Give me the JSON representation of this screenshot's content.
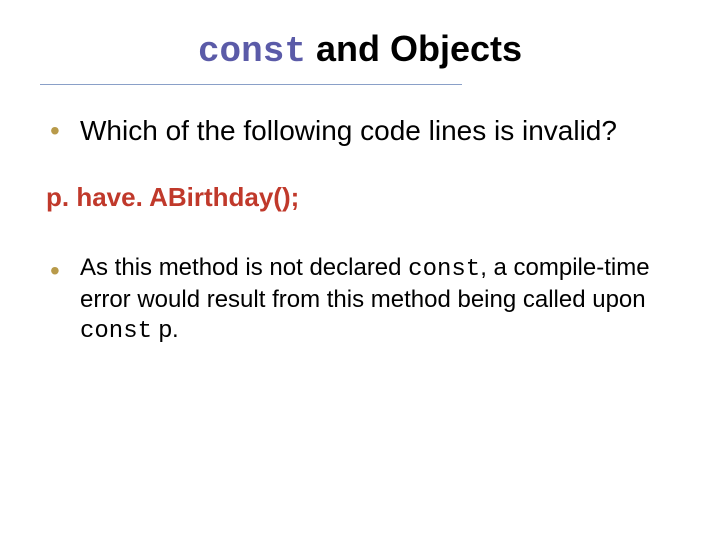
{
  "title": {
    "keyword": "const",
    "rest": " and Objects"
  },
  "bullets": {
    "q": "Which of the following code lines is invalid?",
    "ans_pre": "As this method is not declared ",
    "ans_kw1": "const",
    "ans_mid": ", a compile-time error would result from this method being called upon ",
    "ans_kw2": "const",
    "ans_post": " p."
  },
  "code": {
    "line": "p. have. ABirthday();"
  }
}
